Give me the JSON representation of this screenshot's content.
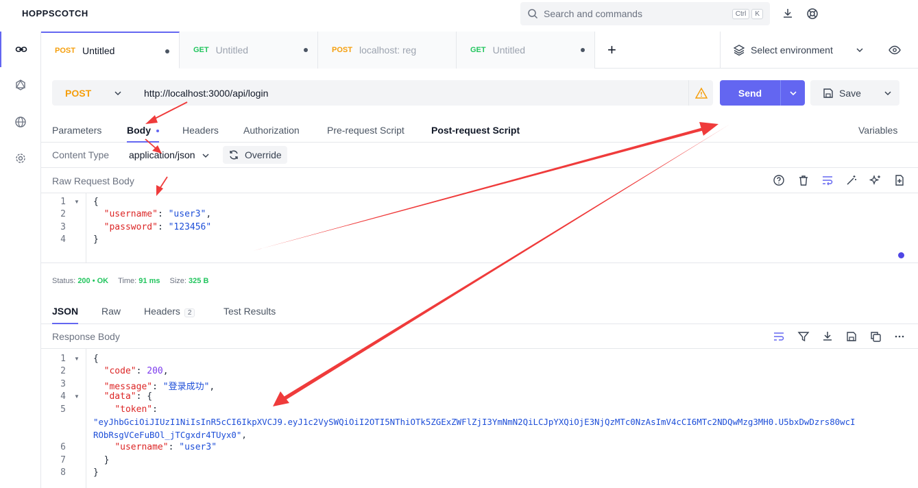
{
  "app": {
    "brand": "HOPPSCOTCH"
  },
  "search": {
    "placeholder": "Search and commands",
    "keys": [
      "Ctrl",
      "K"
    ]
  },
  "icons": {
    "search": "search-icon",
    "download": "download-icon",
    "support": "support-icon",
    "rest": "link-icon",
    "graphql": "graphql-icon",
    "realtime": "globe-icon",
    "settings": "gear-icon",
    "layers": "layers-icon",
    "eye": "eye-icon",
    "warning": "warning-icon",
    "save": "save-icon"
  },
  "colors": {
    "accent": "#6366f1",
    "post": "#f59e0b",
    "get": "#22c55e",
    "key": "#dc2626",
    "string": "#1d4ed8",
    "number": "#7c3aed",
    "annotation": "#ef3b3b"
  },
  "request_tabs": [
    {
      "method": "POST",
      "name": "Untitled"
    },
    {
      "method": "GET",
      "name": "Untitled"
    },
    {
      "method": "POST",
      "name": "localhost: reg"
    },
    {
      "method": "GET",
      "name": "Untitled"
    }
  ],
  "environment": {
    "label": "Select environment"
  },
  "request": {
    "method": "POST",
    "url": "http://localhost:3000/api/login",
    "send_label": "Send",
    "save_label": "Save"
  },
  "request_subtabs": [
    "Parameters",
    "Body",
    "Headers",
    "Authorization",
    "Pre-request Script",
    "Post-request Script",
    "Variables"
  ],
  "content_type": {
    "label": "Content Type",
    "value": "application/json",
    "override": "Override"
  },
  "raw_body": {
    "title": "Raw Request Body",
    "line_numbers": [
      "1",
      "2",
      "3",
      "4"
    ],
    "lines": [
      {
        "p": "{"
      },
      {
        "ind": "  ",
        "key": "\"username\"",
        "sep": ": ",
        "val": "\"user3\"",
        "end": ","
      },
      {
        "ind": "  ",
        "key": "\"password\"",
        "sep": ": ",
        "val": "\"123456\"",
        "end": ""
      },
      {
        "p": "}"
      }
    ]
  },
  "status": {
    "status_label": "Status:",
    "status_value": "200 • OK",
    "time_label": "Time:",
    "time_value": "91 ms",
    "size_label": "Size:",
    "size_value": "325 B"
  },
  "response_tabs": {
    "json": "JSON",
    "raw": "Raw",
    "headers": "Headers",
    "headers_count": "2",
    "tests": "Test Results"
  },
  "response_body": {
    "title": "Response Body",
    "line_numbers": [
      "1",
      "2",
      "3",
      "4",
      "5",
      "6",
      "7",
      "8"
    ],
    "open": "{",
    "code_key": "\"code\"",
    "code_val": "200",
    "message_key": "\"message\"",
    "message_val": "\"登录成功\"",
    "data_key": "\"data\"",
    "data_open": "{",
    "token_key": "\"token\"",
    "token_val_1": "\"eyJhbGciOiJIUzI1NiIsInR5cCI6IkpXVCJ9.eyJ1c2VySWQiOiI2OTI5NThiOTk5ZGExZWFlZjI3YmNmN2QiLCJpYXQiOjE3NjQzMTc0NzAsImV4cCI6MTc2NDQwMzg3MH0.U5bxDwDzrs80wcI",
    "token_val_2": "RObRsgVCeFuBOl_jTCgxdr4TUyx0\"",
    "username_key": "\"username\"",
    "username_val": "\"user3\"",
    "data_close": "}",
    "close": "}"
  }
}
